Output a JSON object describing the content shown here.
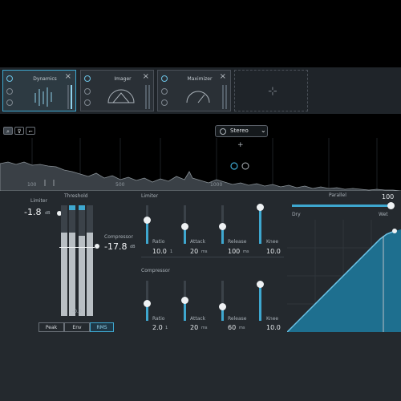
{
  "modules": [
    {
      "name": "Dynamics",
      "active": true
    },
    {
      "name": "Imager",
      "active": false
    },
    {
      "name": "Maximizer",
      "active": false
    }
  ],
  "icons": {
    "power": "power-icon",
    "close": "close-icon",
    "add": "add-module-icon",
    "stereo": "stereo-link-icon",
    "chevron": "chevron-down-icon"
  },
  "toolbar": {
    "tool1": "⌕",
    "tool2": "⊽",
    "tool3": "⌐",
    "stereo_label": "Stereo",
    "chevron": "⌄",
    "plus": "+"
  },
  "spectrum": {
    "freq_labels": [
      "100",
      "500",
      "1000"
    ]
  },
  "limiter": {
    "label": "Limiter",
    "value": "-1.8",
    "unit": "dB"
  },
  "threshold": {
    "label": "Threshold"
  },
  "compressor_threshold": {
    "label": "Compressor",
    "value": "-17.8",
    "unit": "dB"
  },
  "meters": {
    "level_label": "-0.0"
  },
  "detection_modes": [
    "Peak",
    "Env",
    "RMS"
  ],
  "detection_selected": "RMS",
  "limiter_section": {
    "title": "Limiter",
    "controls": [
      {
        "label": "Ratio",
        "value": "10.0",
        "unit": "1"
      },
      {
        "label": "Attack",
        "value": "20",
        "unit": "ms"
      },
      {
        "label": "Release",
        "value": "100",
        "unit": "ms"
      },
      {
        "label": "Knee",
        "value": "10.0",
        "unit": ""
      }
    ]
  },
  "compressor_section": {
    "title": "Compressor",
    "controls": [
      {
        "label": "Ratio",
        "value": "2.0",
        "unit": "1"
      },
      {
        "label": "Attack",
        "value": "20",
        "unit": "ms"
      },
      {
        "label": "Release",
        "value": "60",
        "unit": "ms"
      },
      {
        "label": "Knee",
        "value": "10.0",
        "unit": ""
      }
    ]
  },
  "parallel": {
    "label": "Parallel",
    "value": "100",
    "min_label": "Dry",
    "max_label": "Wet",
    "level_pct": 100
  },
  "colors": {
    "accent": "#3ea7cf",
    "panel": "#24292e",
    "curve_fill": "#1e6f8f"
  }
}
